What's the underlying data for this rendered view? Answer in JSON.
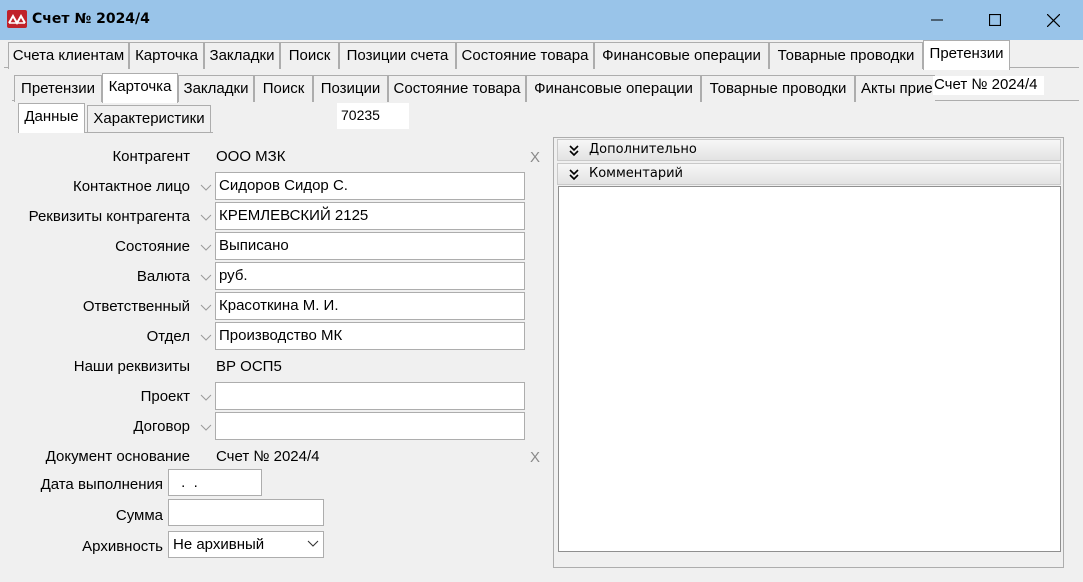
{
  "window": {
    "title": "Счет № 2024/4",
    "icon": "app-logo-icon",
    "controls": [
      "minimize-icon",
      "maximize-icon",
      "close-icon"
    ]
  },
  "top_tabs": [
    {
      "label": "Счета клиентам"
    },
    {
      "label": "Карточка"
    },
    {
      "label": "Закладки"
    },
    {
      "label": "Поиск"
    },
    {
      "label": "Позиции счета"
    },
    {
      "label": "Состояние товара"
    },
    {
      "label": "Финансовые операции"
    },
    {
      "label": "Товарные проводки"
    },
    {
      "label": "Претензии",
      "active": true
    }
  ],
  "second_tabs": [
    {
      "label": "Претензии"
    },
    {
      "label": "Карточка",
      "active": true
    },
    {
      "label": "Закладки"
    },
    {
      "label": "Поиск"
    },
    {
      "label": "Позиции"
    },
    {
      "label": "Состояние товара"
    },
    {
      "label": "Финансовые операции"
    },
    {
      "label": "Товарные проводки"
    },
    {
      "label": "Акты прие"
    }
  ],
  "second_tabs_doc_title": "Счет № 2024/4",
  "third_tabs": [
    {
      "label": "Данные",
      "active": true
    },
    {
      "label": "Характеристики"
    }
  ],
  "record_id": "70235",
  "form": {
    "counterparty_label": "Контрагент",
    "counterparty_value": "ООО МЗК",
    "contact_label": "Контактное лицо",
    "contact_value": "Сидоров Сидор С.",
    "requisites_label": "Реквизиты контрагента",
    "requisites_value": "КРЕМЛЕВСКИЙ 2125",
    "state_label": "Состояние",
    "state_value": "Выписано",
    "currency_label": "Валюта",
    "currency_value": "руб.",
    "responsible_label": "Ответственный",
    "responsible_value": "Красоткина М. И.",
    "department_label": "Отдел",
    "department_value": "Производство МК",
    "our_requisites_label": "Наши реквизиты",
    "our_requisites_value": "ВР ОСП5",
    "project_label": "Проект",
    "project_value": "",
    "contract_label": "Договор",
    "contract_value": "",
    "base_doc_label": "Документ основание",
    "base_doc_value": "Счет № 2024/4",
    "exec_date_label": "Дата выполнения",
    "exec_date_value": " .  .",
    "sum_label": "Сумма",
    "sum_value": "",
    "archive_label": "Архивность",
    "archive_value": "Не архивный",
    "clear_symbol": "X"
  },
  "right": {
    "additional_label": "Дополнительно",
    "comment_label": "Комментарий",
    "comment_value": ""
  }
}
